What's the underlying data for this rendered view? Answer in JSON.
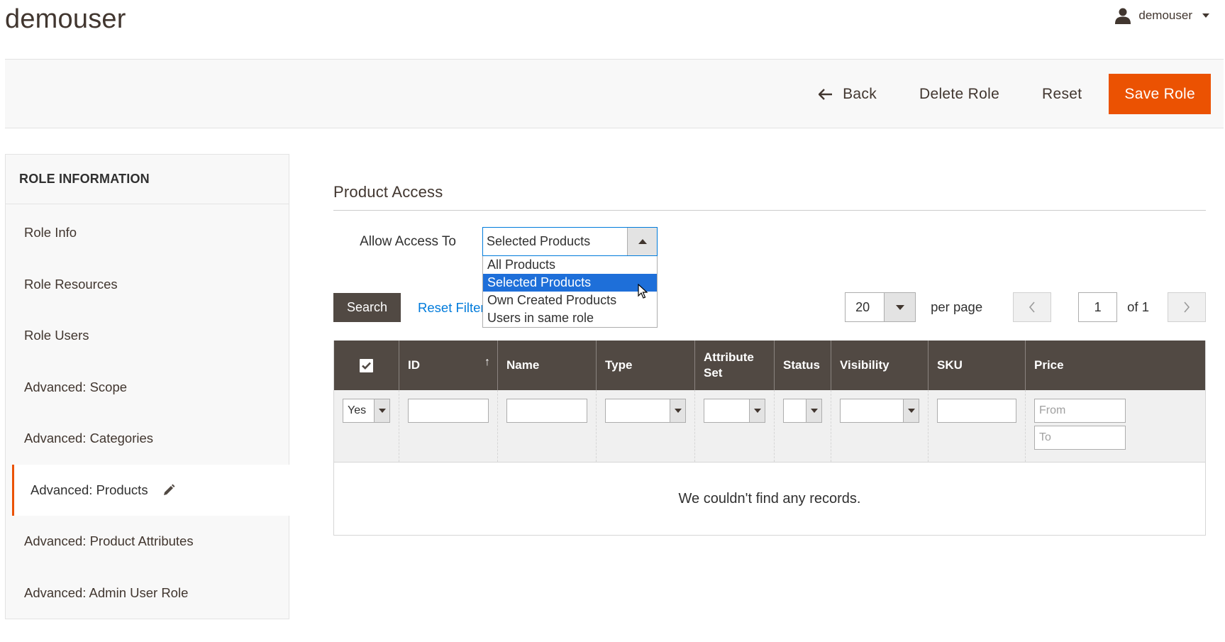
{
  "header": {
    "page_title": "demouser",
    "account_name": "demouser"
  },
  "toolbar": {
    "back_label": "Back",
    "delete_label": "Delete Role",
    "reset_label": "Reset",
    "save_label": "Save Role"
  },
  "sidebar": {
    "title": "ROLE INFORMATION",
    "items": [
      {
        "label": "Role Info"
      },
      {
        "label": "Role Resources"
      },
      {
        "label": "Role Users"
      },
      {
        "label": "Advanced: Scope"
      },
      {
        "label": "Advanced: Categories"
      },
      {
        "label": "Advanced: Products",
        "active": true
      },
      {
        "label": "Advanced: Product Attributes"
      },
      {
        "label": "Advanced: Admin User Role"
      }
    ]
  },
  "main": {
    "section_title": "Product Access",
    "allow_access": {
      "label": "Allow Access To",
      "selected": "Selected Products",
      "options": [
        "All Products",
        "Selected Products",
        "Own Created Products",
        "Users in same role"
      ]
    },
    "search_label": "Search",
    "reset_filter_label": "Reset Filter",
    "pager": {
      "per_page_value": "20",
      "per_page_label": "per page",
      "current_page": "1",
      "of_label": "of 1"
    },
    "grid": {
      "columns": [
        "ID",
        "Name",
        "Type",
        "Attribute Set",
        "Status",
        "Visibility",
        "SKU",
        "Price"
      ],
      "filters": {
        "in_role": "Yes",
        "price_from_placeholder": "From",
        "price_to_placeholder": "To"
      },
      "empty_message": "We couldn't find any records."
    }
  },
  "colors": {
    "accent": "#eb5202",
    "header_bg": "#514943",
    "link": "#007bdb",
    "selected_option": "#1e6fd9"
  }
}
